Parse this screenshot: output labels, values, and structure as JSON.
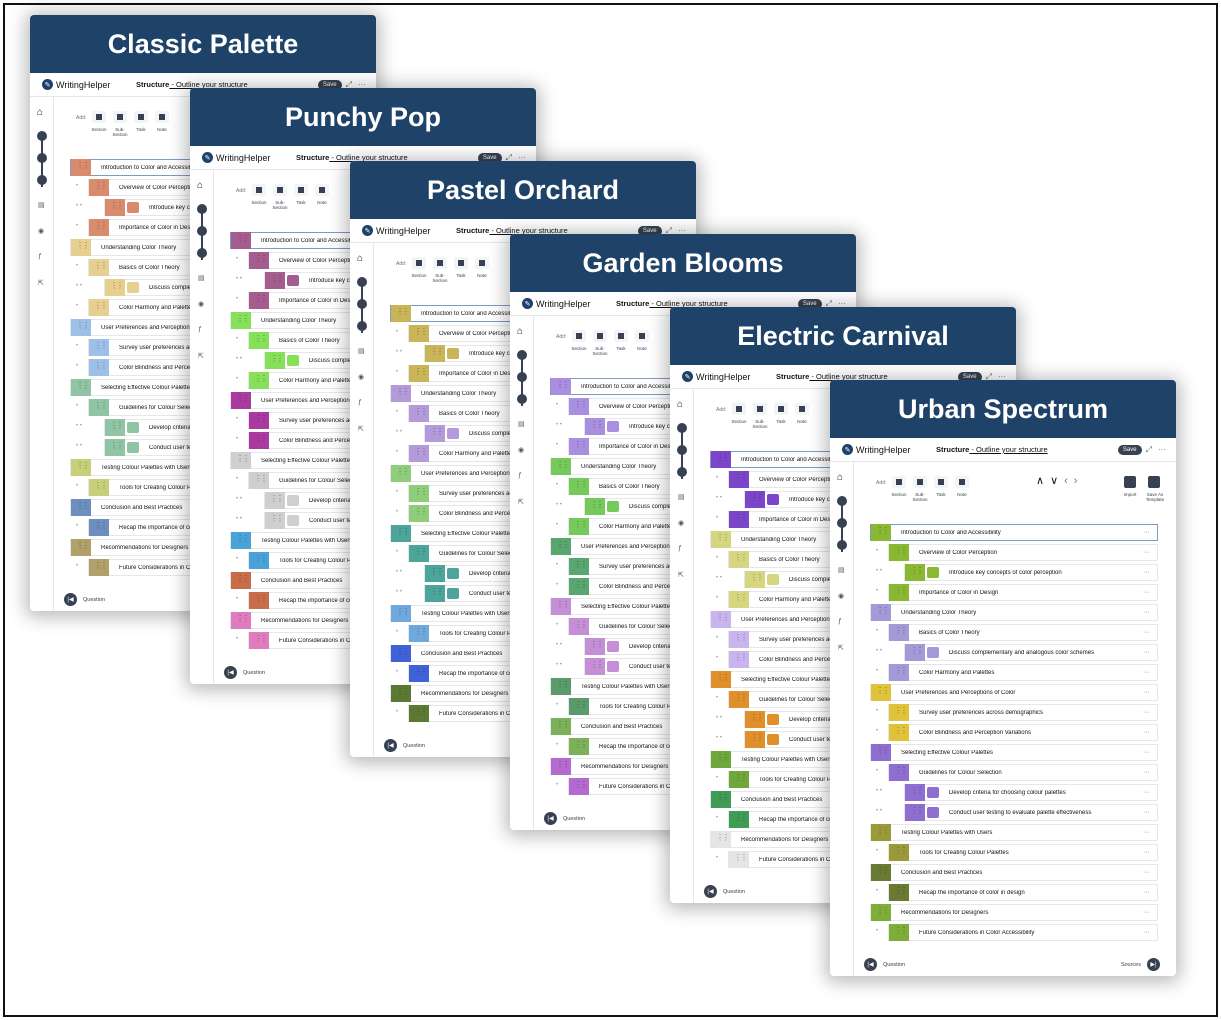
{
  "app": {
    "logo_text": "WritingHelper",
    "structure_prefix": "Structure",
    "structure_suffix": " - Outline your structure",
    "save_label": "Save",
    "add_label": "Add:",
    "add_buttons": [
      "Section",
      "Sub-\nSection",
      "Task",
      "Note"
    ],
    "import_label": "Import",
    "save_template_label": "Save As\nTemplate",
    "question_label": "Question",
    "sources_label": "Sources"
  },
  "cards": [
    {
      "title": "Classic Palette",
      "colors": [
        "#d98c6d",
        "#e6cf8f",
        "#9cc0e8",
        "#8fc4a4",
        "#c7cf78",
        "#6c8fbd",
        "#b0a06a",
        "#d9b97c"
      ]
    },
    {
      "title": "Punchy Pop",
      "colors": [
        "#a55c8f",
        "#86e05a",
        "#a93ba0",
        "#cfcfcf",
        "#4aa3d8",
        "#c86d4a",
        "#e07bbf",
        "#e0b85a"
      ]
    },
    {
      "title": "Pastel Orchard",
      "colors": [
        "#c9b45a",
        "#b39ad8",
        "#8fcd7a",
        "#4da49b",
        "#6fa8dc",
        "#3f62d6",
        "#5a7a33",
        "#d1a05a"
      ]
    },
    {
      "title": "Garden Blooms",
      "colors": [
        "#a98fe0",
        "#76c95b",
        "#5aa66f",
        "#c48fd6",
        "#5b9a6a",
        "#7cb15a",
        "#b36bd0",
        "#e3d3ee"
      ]
    },
    {
      "title": "Electric Carnival",
      "colors": [
        "#7b46c9",
        "#d6d680",
        "#c9b4ee",
        "#e0902a",
        "#6ea83a",
        "#3f9b55",
        "#e5e5e5",
        "#a4c8ee"
      ]
    },
    {
      "title": "Urban Spectrum",
      "colors": [
        "#8ab832",
        "#a59ad8",
        "#e0c33a",
        "#8e6fd0",
        "#9a9a3a",
        "#6b7a33",
        "#7fae38",
        "#4a4ae0"
      ]
    }
  ],
  "outline": [
    {
      "level": 1,
      "text": "Introduction to Color and Accessibility"
    },
    {
      "level": 2,
      "text": "Overview of Color Perception"
    },
    {
      "level": 3,
      "text": "Introduce key concepts of color perception"
    },
    {
      "level": 2,
      "text": "Importance of Color in Design"
    },
    {
      "level": 1,
      "text": "Understanding Color Theory"
    },
    {
      "level": 2,
      "text": "Basics of Color Theory"
    },
    {
      "level": 3,
      "text": "Discuss complementary and analogous color schemes"
    },
    {
      "level": 2,
      "text": "Color Harmony and Palettes"
    },
    {
      "level": 1,
      "text": "User Preferences and Perceptions of Color"
    },
    {
      "level": 2,
      "text": "Survey user preferences across demographics"
    },
    {
      "level": 2,
      "text": "Color Blindness and Perception Variations"
    },
    {
      "level": 1,
      "text": "Selecting Effective Colour Palettes"
    },
    {
      "level": 2,
      "text": "Guidelines for Colour Selection"
    },
    {
      "level": 3,
      "text": "Develop criteria for choosing colour palettes"
    },
    {
      "level": 3,
      "text": "Conduct user testing to evaluate palette effectiveness"
    },
    {
      "level": 1,
      "text": "Testing Colour Palettes with Users"
    },
    {
      "level": 2,
      "text": "Tools for Creating Colour Palettes"
    },
    {
      "level": 1,
      "text": "Conclusion and Best Practices"
    },
    {
      "level": 2,
      "text": "Recap the importance of color in design"
    },
    {
      "level": 1,
      "text": "Recommendations for Designers"
    },
    {
      "level": 2,
      "text": "Future Considerations in Color Accessibility"
    }
  ]
}
